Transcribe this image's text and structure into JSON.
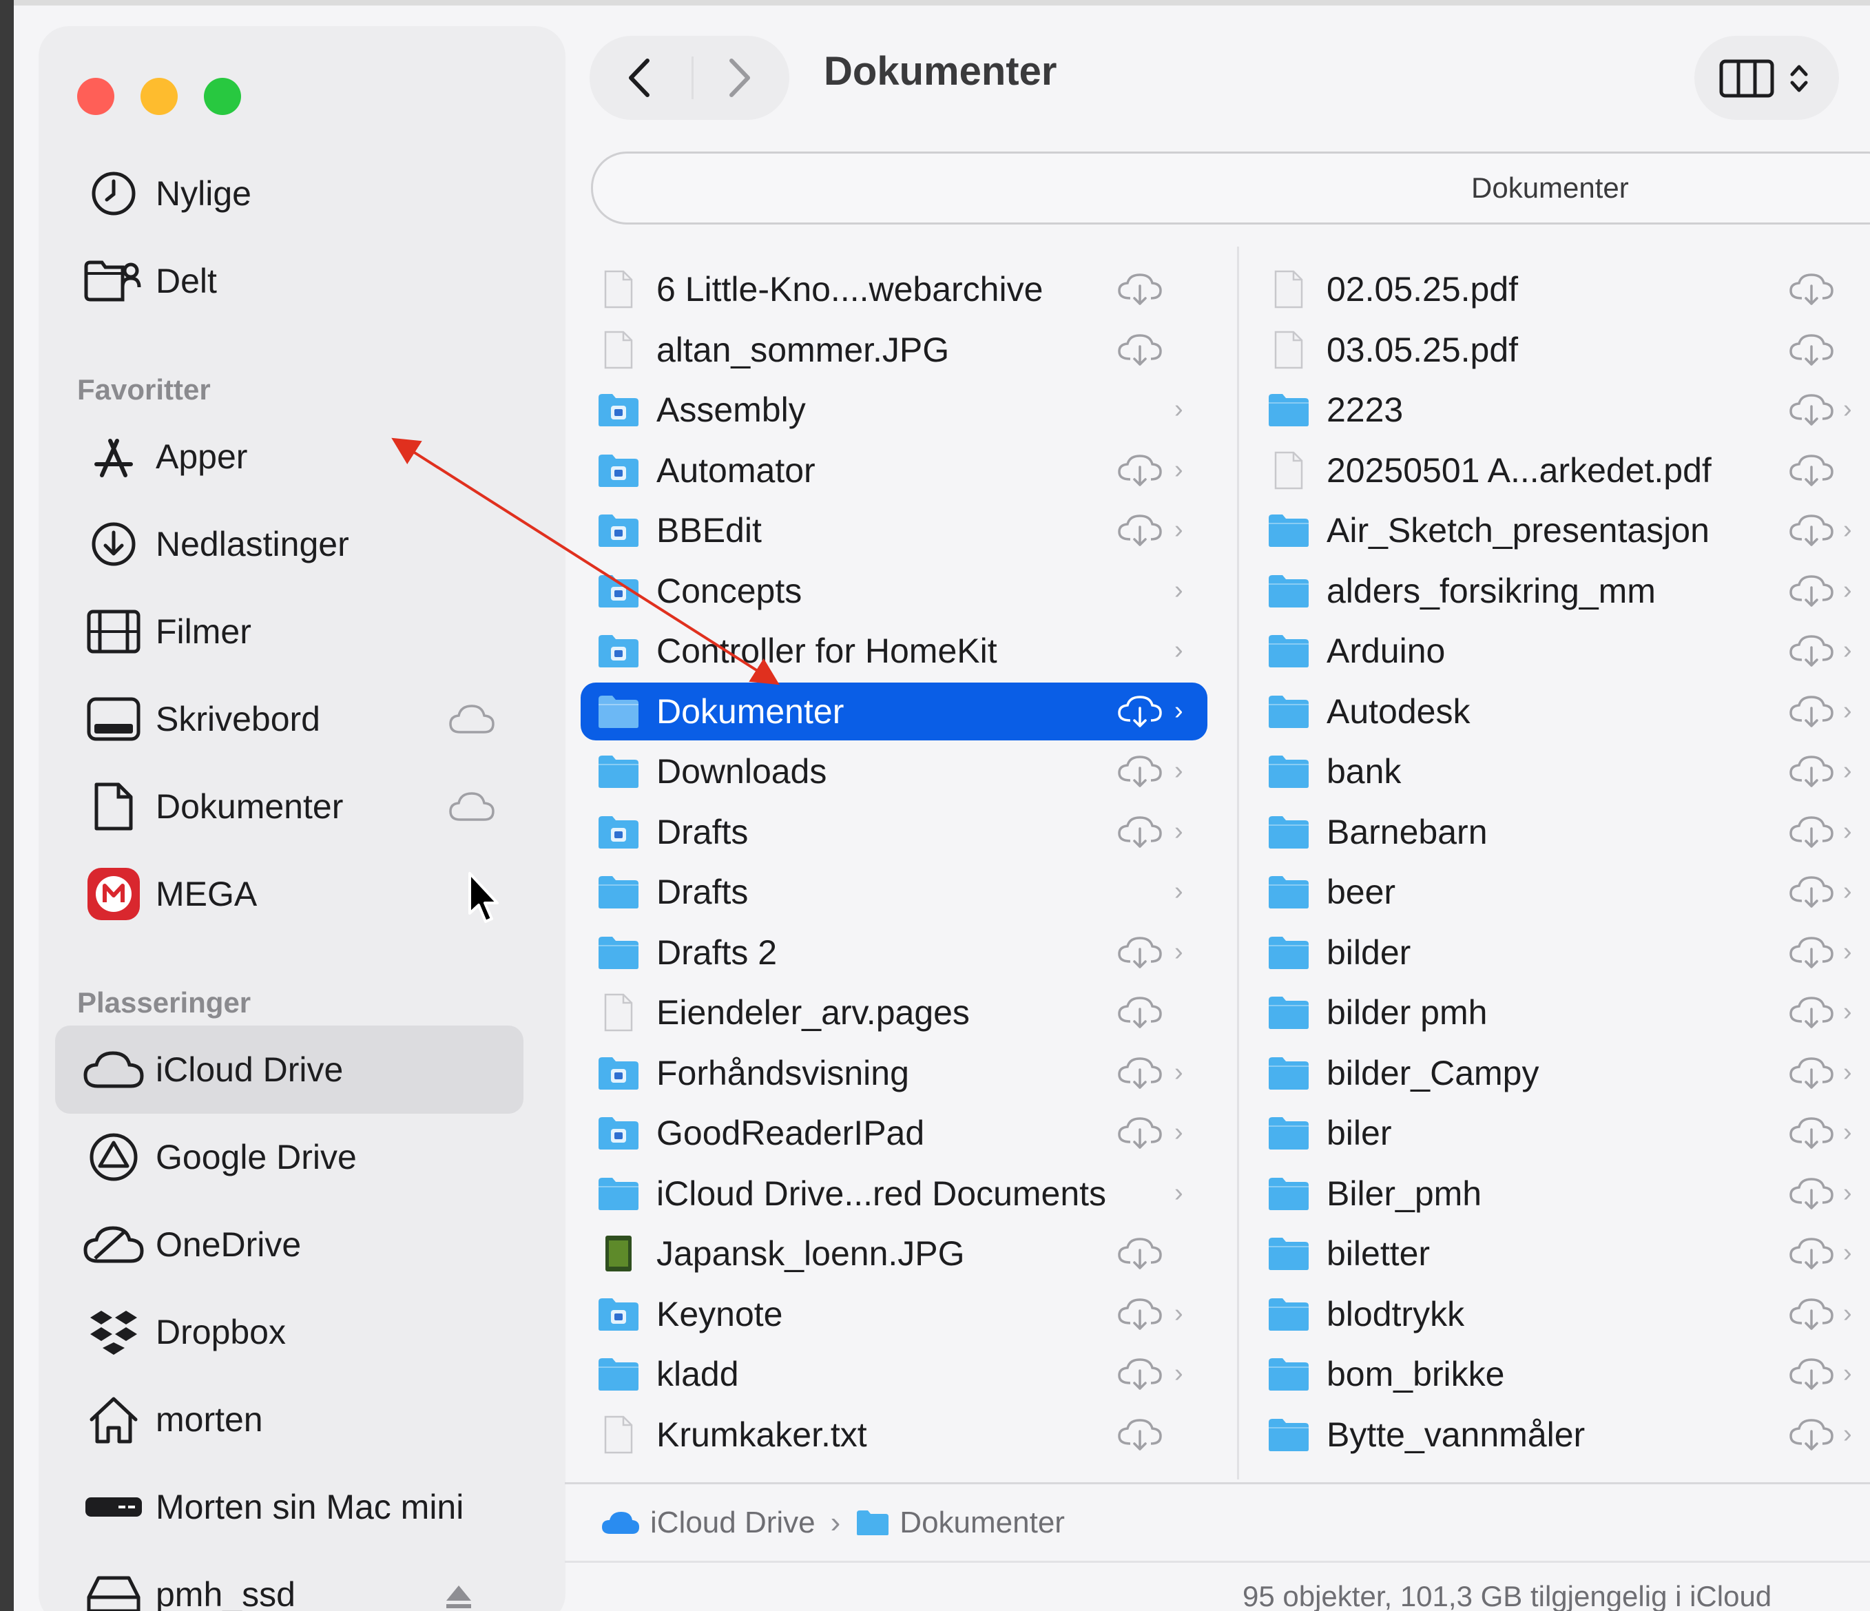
{
  "window": {
    "title": "Dokumenter",
    "path_bar": "Dokumenter"
  },
  "sidebar": {
    "top_items": [
      {
        "label": "Nylige",
        "icon": "clock-icon"
      },
      {
        "label": "Delt",
        "icon": "shared-folder-icon"
      }
    ],
    "favorites_heading": "Favoritter",
    "favorites": [
      {
        "label": "Apper",
        "icon": "apps-icon"
      },
      {
        "label": "Nedlastinger",
        "icon": "download-icon"
      },
      {
        "label": "Filmer",
        "icon": "film-icon"
      },
      {
        "label": "Skrivebord",
        "icon": "desktop-icon",
        "cloud": true
      },
      {
        "label": "Dokumenter",
        "icon": "document-icon",
        "cloud": true
      },
      {
        "label": "MEGA",
        "icon": "mega-icon"
      }
    ],
    "locations_heading": "Plasseringer",
    "locations": [
      {
        "label": "iCloud Drive",
        "icon": "icloud-icon",
        "selected": true
      },
      {
        "label": "Google Drive",
        "icon": "google-drive-icon"
      },
      {
        "label": "OneDrive",
        "icon": "onedrive-icon"
      },
      {
        "label": "Dropbox",
        "icon": "dropbox-icon"
      },
      {
        "label": "morten",
        "icon": "home-icon"
      },
      {
        "label": "Morten sin Mac mini",
        "icon": "mac-mini-icon"
      },
      {
        "label": "pmh_ssd",
        "icon": "external-drive-icon",
        "eject": true
      }
    ]
  },
  "column1": [
    {
      "name": "6 Little-Kno....webarchive",
      "type": "file",
      "cloud": true,
      "chevron": false
    },
    {
      "name": "altan_sommer.JPG",
      "type": "file",
      "cloud": true,
      "chevron": false
    },
    {
      "name": "Assembly",
      "type": "app-folder",
      "cloud": false,
      "chevron": true
    },
    {
      "name": "Automator",
      "type": "app-folder",
      "cloud": true,
      "chevron": true
    },
    {
      "name": "BBEdit",
      "type": "app-folder",
      "cloud": true,
      "chevron": true
    },
    {
      "name": "Concepts",
      "type": "app-folder",
      "cloud": false,
      "chevron": true
    },
    {
      "name": "Controller for HomeKit",
      "type": "app-folder",
      "cloud": false,
      "chevron": true
    },
    {
      "name": "Dokumenter",
      "type": "folder",
      "cloud": true,
      "chevron": true,
      "selected": true
    },
    {
      "name": "Downloads",
      "type": "folder",
      "cloud": true,
      "chevron": true
    },
    {
      "name": "Drafts",
      "type": "app-folder",
      "cloud": true,
      "chevron": true
    },
    {
      "name": "Drafts",
      "type": "folder",
      "cloud": false,
      "chevron": true
    },
    {
      "name": "Drafts 2",
      "type": "folder",
      "cloud": true,
      "chevron": true
    },
    {
      "name": "Eiendeler_arv.pages",
      "type": "file",
      "cloud": true,
      "chevron": false
    },
    {
      "name": "Forhåndsvisning",
      "type": "app-folder",
      "cloud": true,
      "chevron": true
    },
    {
      "name": "GoodReaderIPad",
      "type": "app-folder",
      "cloud": true,
      "chevron": true
    },
    {
      "name": "iCloud Drive...red Documents",
      "type": "folder",
      "cloud": false,
      "chevron": true
    },
    {
      "name": "Japansk_loenn.JPG",
      "type": "image",
      "cloud": true,
      "chevron": false
    },
    {
      "name": "Keynote",
      "type": "app-folder",
      "cloud": true,
      "chevron": true
    },
    {
      "name": "kladd",
      "type": "folder",
      "cloud": true,
      "chevron": true
    },
    {
      "name": "Krumkaker.txt",
      "type": "file",
      "cloud": true,
      "chevron": false
    }
  ],
  "column2": [
    {
      "name": "02.05.25.pdf",
      "type": "file",
      "chevron": false
    },
    {
      "name": "03.05.25.pdf",
      "type": "file",
      "chevron": false
    },
    {
      "name": "2223",
      "type": "folder",
      "chevron": true
    },
    {
      "name": "20250501 A...arkedet.pdf",
      "type": "file",
      "chevron": false
    },
    {
      "name": "Air_Sketch_presentasjon",
      "type": "folder",
      "chevron": true
    },
    {
      "name": "alders_forsikring_mm",
      "type": "folder",
      "chevron": true
    },
    {
      "name": "Arduino",
      "type": "folder",
      "chevron": true
    },
    {
      "name": "Autodesk",
      "type": "folder",
      "chevron": true
    },
    {
      "name": "bank",
      "type": "folder",
      "chevron": true
    },
    {
      "name": "Barnebarn",
      "type": "folder",
      "chevron": true
    },
    {
      "name": "beer",
      "type": "folder",
      "chevron": true
    },
    {
      "name": "bilder",
      "type": "folder",
      "chevron": true
    },
    {
      "name": "bilder pmh",
      "type": "folder",
      "chevron": true
    },
    {
      "name": "bilder_Campy",
      "type": "folder",
      "chevron": true
    },
    {
      "name": "biler",
      "type": "folder",
      "chevron": true
    },
    {
      "name": "Biler_pmh",
      "type": "folder",
      "chevron": true
    },
    {
      "name": "biletter",
      "type": "folder",
      "chevron": true
    },
    {
      "name": "blodtrykk",
      "type": "folder",
      "chevron": true
    },
    {
      "name": "bom_brikke",
      "type": "folder",
      "chevron": true
    },
    {
      "name": "Bytte_vannmåler",
      "type": "folder",
      "chevron": true
    }
  ],
  "breadcrumbs": [
    "iCloud Drive",
    "Dokumenter"
  ],
  "status": "95 objekter, 101,3 GB tilgjengelig i iCloud",
  "colors": {
    "selection": "#0a5ee6",
    "folder": "#49b1ef",
    "annotation_arrow": "#e0301e"
  }
}
